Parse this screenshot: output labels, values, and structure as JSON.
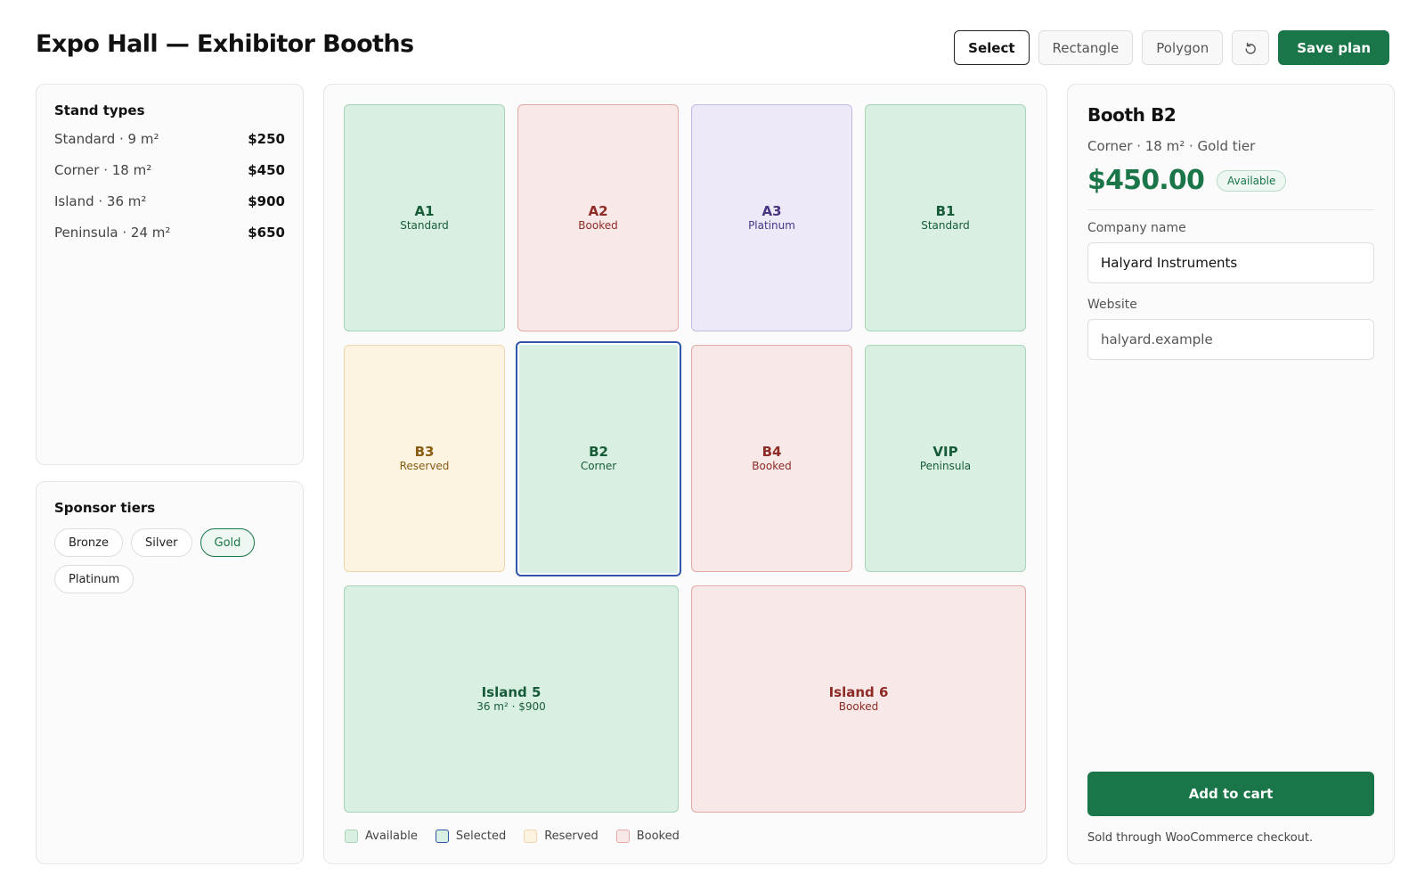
{
  "header": {
    "title": "Expo Hall — Exhibitor Booths"
  },
  "toolbar": {
    "select_label": "Select",
    "rectangle_label": "Rectangle",
    "polygon_label": "Polygon",
    "undo_icon": "undo-icon",
    "save_label": "Save plan",
    "active_tool": "Select"
  },
  "stand_types": {
    "title": "Stand types",
    "items": [
      {
        "name": "Standard · 9 m²",
        "price": "$250"
      },
      {
        "name": "Corner · 18 m²",
        "price": "$450"
      },
      {
        "name": "Island · 36 m²",
        "price": "$900"
      },
      {
        "name": "Peninsula · 24 m²",
        "price": "$650"
      }
    ]
  },
  "sponsor_tiers": {
    "title": "Sponsor tiers",
    "chips": [
      "Bronze",
      "Silver",
      "Gold",
      "Platinum"
    ],
    "selected": "Gold"
  },
  "floor": {
    "booths": [
      {
        "name": "A1",
        "sub": "Standard",
        "status": "available"
      },
      {
        "name": "A2",
        "sub": "Booked",
        "status": "booked"
      },
      {
        "name": "A3",
        "sub": "Platinum",
        "status": "platinum"
      },
      {
        "name": "B1",
        "sub": "Standard",
        "status": "available"
      },
      {
        "name": "B3",
        "sub": "Reserved",
        "status": "reserved"
      },
      {
        "name": "B2",
        "sub": "Corner",
        "status": "selected"
      },
      {
        "name": "B4",
        "sub": "Booked",
        "status": "booked"
      },
      {
        "name": "VIP",
        "sub": "Peninsula",
        "status": "available"
      },
      {
        "name": "Island 5",
        "sub": "36 m² · $900",
        "status": "available"
      },
      {
        "name": "Island 6",
        "sub": "Booked",
        "status": "booked"
      }
    ],
    "legend": [
      "Available",
      "Selected",
      "Reserved",
      "Booked"
    ]
  },
  "colors": {
    "accent": "#1a7548",
    "available": "#d9efe2",
    "booked": "#f8e8e7",
    "reserved": "#fdf3e1",
    "platinum": "#ede9f8",
    "selected_border": "#2f56a8"
  },
  "detail": {
    "title": "Booth B2",
    "meta": "Corner · 18 m² · Gold tier",
    "price": "$450.00",
    "status_badge": "Available",
    "company_label": "Company name",
    "company_value": "Halyard Instruments",
    "website_label": "Website",
    "website_placeholder": "halyard.example",
    "cart_label": "Add to cart",
    "note": "Sold through WooCommerce checkout."
  }
}
